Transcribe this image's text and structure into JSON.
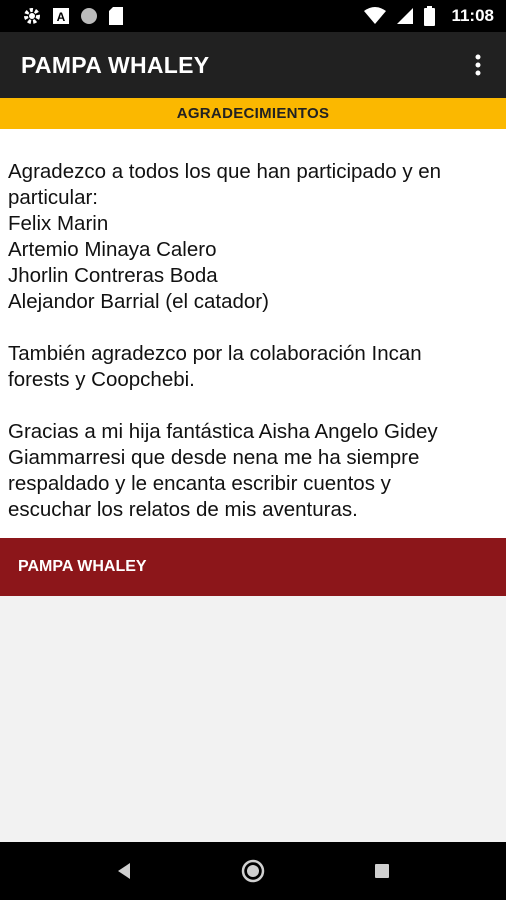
{
  "status_bar": {
    "time": "11:08",
    "icons_left": [
      "gear-icon",
      "a-box-icon",
      "circle-icon",
      "sd-card-icon"
    ],
    "icons_right": [
      "wifi-icon",
      "signal-icon",
      "battery-icon"
    ]
  },
  "app_bar": {
    "title": "PAMPA WHALEY",
    "overflow_icon": "more-vert-icon"
  },
  "section": {
    "title": "AGRADECIMIENTOS"
  },
  "content": {
    "para1_lines": [
      "Agradezco a todos los que han participado y en",
      "particular:",
      "Felix Marin",
      "Artemio Minaya Calero",
      "Jhorlin Contreras Boda",
      "Alejandor Barrial (el catador)"
    ],
    "para2_lines": [
      "También agradezco por la colaboración Incan",
      "forests y Coopchebi."
    ],
    "para3_lines": [
      "Gracias a mi hija fantástica Aisha Angelo Gidey",
      "Giammarresi que desde nena me ha siempre",
      "respaldado y le encanta escribir cuentos y",
      "escuchar los relatos de mis aventuras."
    ]
  },
  "footer": {
    "label": "PAMPA WHALEY"
  },
  "colors": {
    "status_bar": "#000000",
    "app_bar": "#212121",
    "accent_yellow": "#fbb800",
    "banner_red": "#8c161a"
  }
}
